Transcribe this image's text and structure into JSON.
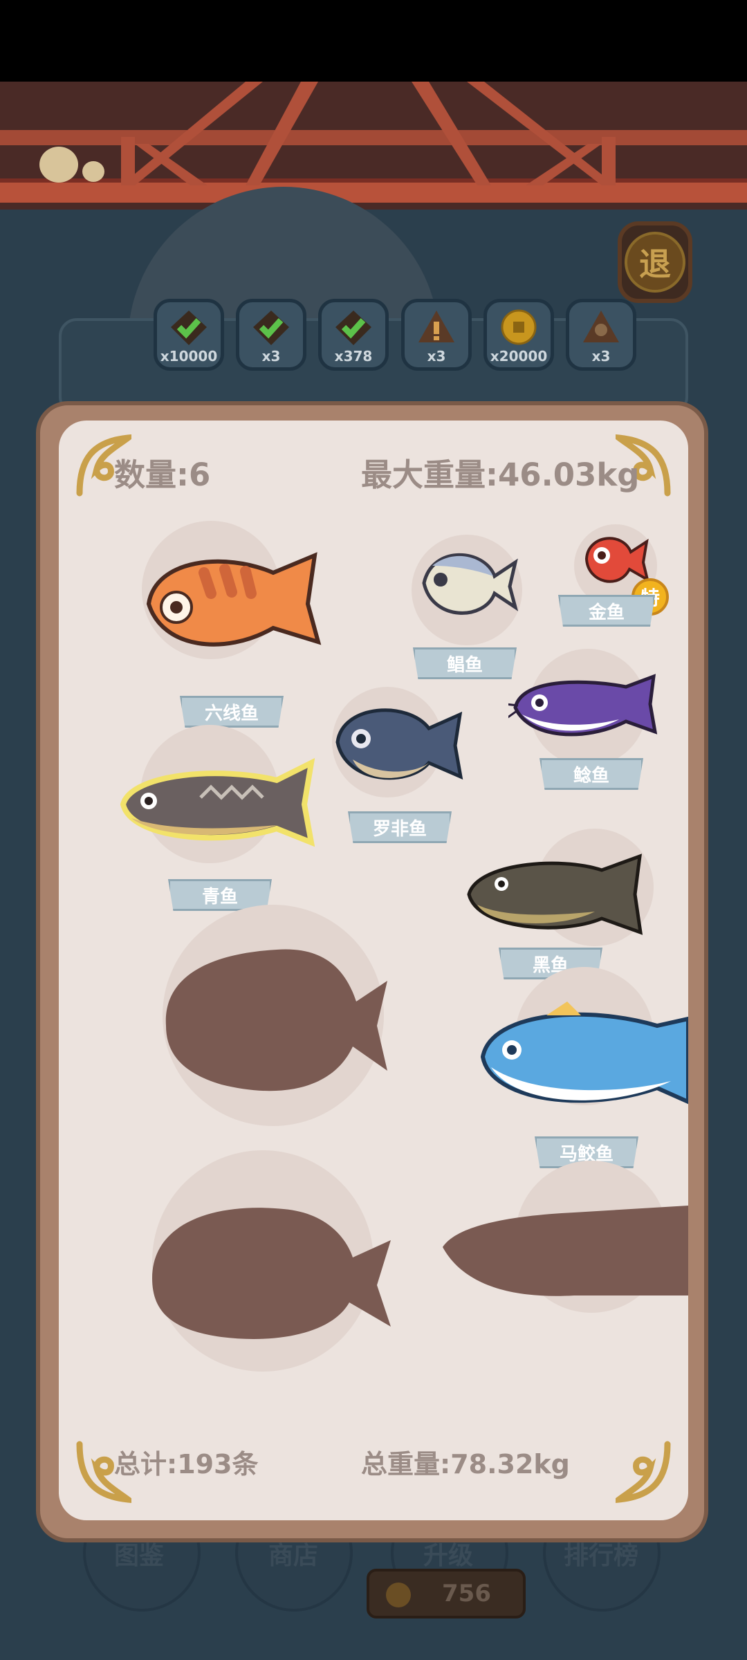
{
  "header": {
    "count_label": "数量:6",
    "max_weight_label": "最大重量:46.03kg"
  },
  "footer": {
    "total_label": "总计:193条",
    "total_weight_label": "总重量:78.32kg"
  },
  "back_button": {
    "label": "退"
  },
  "rewards": [
    {
      "qty": "x10000",
      "icon": "check-badge-icon"
    },
    {
      "qty": "x3",
      "icon": "check-badge-icon"
    },
    {
      "qty": "x378",
      "icon": "check-badge-icon"
    },
    {
      "qty": "x3",
      "icon": "warning-badge-icon"
    },
    {
      "qty": "x20000",
      "icon": "coin-icon"
    },
    {
      "qty": "x3",
      "icon": "clover-badge-icon"
    }
  ],
  "fish": {
    "liuxian": "六线鱼",
    "chang": "鲳鱼",
    "jinyu": "金鱼",
    "jinyu_badge": "特",
    "nian": "鲶鱼",
    "luofei": "罗非鱼",
    "qing": "青鱼",
    "hei": "黑鱼",
    "majiao": "马鲛鱼"
  },
  "nav": [
    "图鉴",
    "商店",
    "升级",
    "排行榜"
  ],
  "coins": "756",
  "colors": {
    "panel": "#ece3de",
    "frame": "#a9826c",
    "text": "#9b8c86",
    "silhouette": "#7a5a52"
  }
}
